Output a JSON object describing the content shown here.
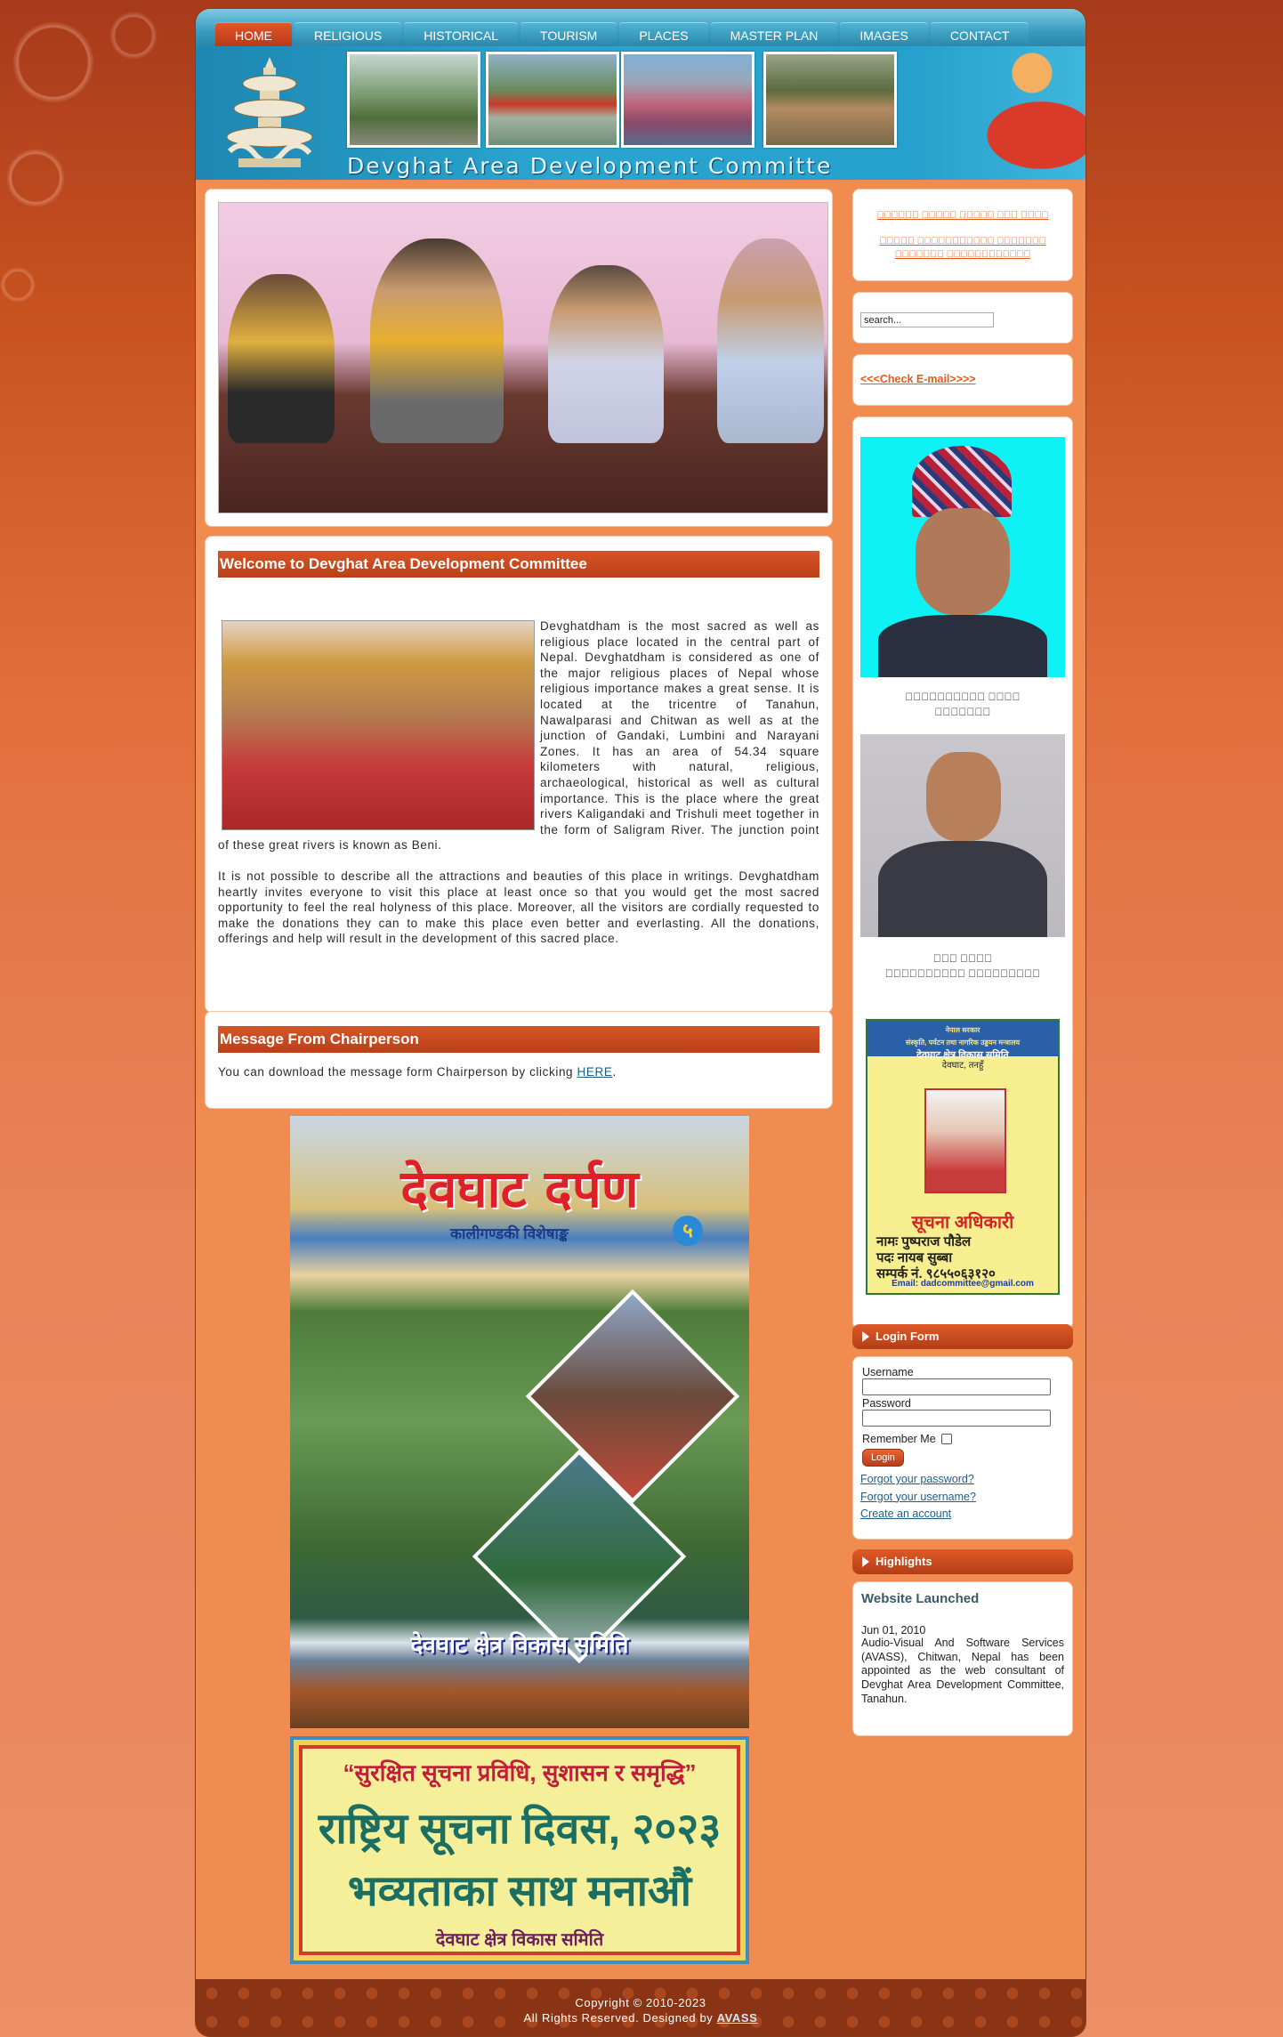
{
  "nav": {
    "items": [
      {
        "label": "HOME"
      },
      {
        "label": "RELIGIOUS"
      },
      {
        "label": "HISTORICAL"
      },
      {
        "label": "TOURISM"
      },
      {
        "label": "PLACES"
      },
      {
        "label": "MASTER PLAN"
      },
      {
        "label": "IMAGES"
      },
      {
        "label": "CONTACT"
      }
    ],
    "active": "HOME"
  },
  "header": {
    "title": "Devghat Area Development Committe"
  },
  "welcome": {
    "heading": "Welcome to Devghat Area Development Committee",
    "para1": "Devghatdham is the most sacred as well as religious place located in the central part of Nepal. Devghatdham is considered as one of the major religious places of Nepal whose religious importance makes a great sense. It is located at the tricentre of Tanahun, Nawalparasi and Chitwan as well as at the junction of Gandaki, Lumbini and Narayani Zones. It has an area of 54.34 square kilometers with natural, religious, archaeological, historical as well as cultural importance. This is the place where the great rivers Kaligandaki and Trishuli meet together in the form of Saligram River. The junction point of these great rivers is known as Beni.",
    "para2": "It is not possible to describe all the attractions and beauties of this place in writings. Devghatdham heartly invites everyone to visit this place at least once so that you would get the most sacred opportunity to feel the real holyness of this place. Moreover, all the visitors are cordially requested to make the donations they can to make this place even better and everlasting. All the donations, offerings and help will result in the development of this sacred place."
  },
  "chairperson": {
    "heading": "Message From Chairperson",
    "text_before": "You can download the message form Chairperson by clicking ",
    "link": "HERE",
    "text_after": "."
  },
  "poster1": {
    "title": "देवघाट दर्पण",
    "subtitle": "कालीगण्डकी विशेषाङ्क",
    "badge": "५",
    "footer": "देवघाट क्षेत्र विकास समिति"
  },
  "poster2": {
    "line1": "“सुरक्षित सूचना प्रविधि, सुशासन र समृद्धि”",
    "line2": "राष्ट्रिय सूचना दिवस, २०२३",
    "line3": "भव्यताका साथ मनाऔं",
    "line4": "देवघाट क्षेत्र विकास समिति"
  },
  "sidebar": {
    "links": [
      "\u0000\u0000\u0000\u0000\u0000\u0000 \u0000\u0000\u0000\u0000\u0000 \u0000\u0000\u0000\u0000\u0000 \u0000\u0000\u0000 \u0000\u0000\u0000\u0000",
      "\u0000\u0000\u0000\u0000\u0000 \u0000\u0000\u0000\u0000\u0000\u0000\u0000\u0000\u0000\u0000\u0000 \u0000\u0000\u0000\u0000\u0000\u0000\u0000 \u0000\u0000\u0000\u0000\u0000\u0000\u0000 \u0000\u0000\u0000\u0000\u0000\u0000\u0000\u0000\u0000\u0000\u0000\u0000"
    ],
    "search_value": "search...",
    "check_email": "<<<Check E-mail>>>>",
    "person1": {
      "name": "\u0000\u0000\u0000\u0000\u0000\u0000\u0000\u0000\u0000\u0000 \u0000\u0000\u0000\u0000",
      "role": "\u0000\u0000\u0000\u0000\u0000\u0000\u0000"
    },
    "person2": {
      "name": "\u0000\u0000\u0000 \u0000\u0000\u0000\u0000",
      "role": "\u0000\u0000\u0000\u0000\u0000\u0000\u0000\u0000\u0000\u0000 \u0000\u0000\u0000\u0000\u0000\u0000\u0000\u0000\u0000"
    },
    "info_card": {
      "org_small": "नेपाल सरकार",
      "org_ministry": "संस्कृति, पर्यटन तथा नागरिक उड्डयन मन्त्रालय",
      "org_name": "देवघाट क्षेत्र विकास समिति",
      "org_place": "देवघाट, तनहुँ",
      "title": "सूचना अधिकारी",
      "name": "नामः पुष्पराज पौडेल",
      "post": "पदः नायब सुब्बा",
      "contact": "सम्पर्क नं. ९८५५०६३१२०",
      "email": "Email: dadcommittee@gmail.com"
    }
  },
  "login": {
    "title": "Login Form",
    "username_label": "Username",
    "password_label": "Password",
    "remember_label": "Remember Me",
    "button": "Login",
    "forgot_password": "Forgot your password?",
    "forgot_username": "Forgot your username?",
    "create_account": "Create an account"
  },
  "highlights": {
    "title": "Highlights",
    "item_title": "Website Launched",
    "item_date": "Jun 01, 2010",
    "item_text": "Audio-Visual And Software Services (AVASS), Chitwan, Nepal has been appointed as the web consultant of Devghat Area Development Committee, Tanahun."
  },
  "footer": {
    "copyright": "Copyright © 2010-2023",
    "reserved": "All Rights Reserved. Designed by ",
    "designer": "AVASS"
  },
  "colors": {
    "accent": "#b9401a",
    "nav_blue": "#2b87ab",
    "link": "#e35b16"
  }
}
